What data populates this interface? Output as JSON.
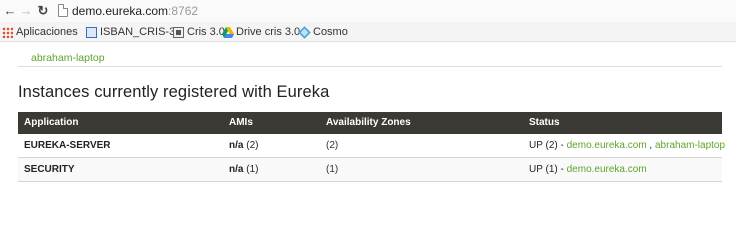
{
  "browser": {
    "url_host": "demo.eureka.com",
    "url_port": ":8762",
    "bookmarks": [
      {
        "label": "Aplicaciones",
        "icon": "apps-grid-icon"
      },
      {
        "label": "ISBAN_CRIS-3.0",
        "icon": "isban-icon"
      },
      {
        "label": "Cris 3.0",
        "icon": "cris-icon"
      },
      {
        "label": "Drive cris 3.0",
        "icon": "google-drive-icon"
      },
      {
        "label": "Cosmo",
        "icon": "cosmo-diamond-icon"
      }
    ]
  },
  "page": {
    "prev_link": "abraham-laptop",
    "heading": "Instances currently registered with Eureka",
    "table": {
      "headers": {
        "application": "Application",
        "amis": "AMIs",
        "zones": "Availability Zones",
        "status": "Status"
      },
      "rows": [
        {
          "application": "EUREKA-SERVER",
          "ami_na": "n/a",
          "ami_count": "(2)",
          "zones": "(2)",
          "status_prefix": "UP (2) - ",
          "link1": "demo.eureka.com",
          "sep": " , ",
          "link2": "abraham-laptop"
        },
        {
          "application": "SECURITY",
          "ami_na": "n/a",
          "ami_count": "(1)",
          "zones": "(1)",
          "status_prefix": "UP (1) - ",
          "link1": "demo.eureka.com"
        }
      ]
    }
  },
  "colors": {
    "link_green": "#5fa32b",
    "header_bg": "#3b3a35"
  }
}
